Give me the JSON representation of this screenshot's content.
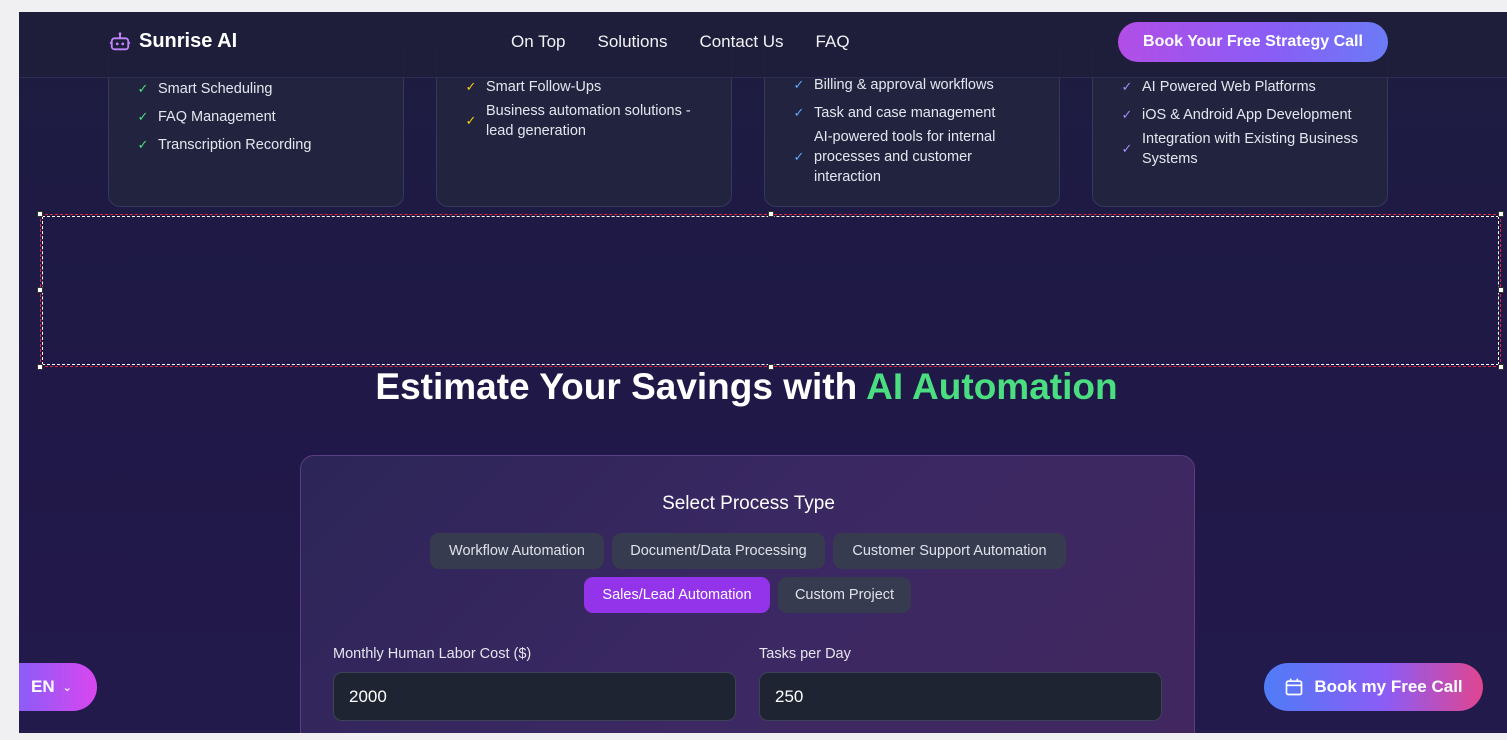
{
  "header": {
    "brand": "Sunrise AI",
    "nav": [
      "On Top",
      "Solutions",
      "Contact Us",
      "FAQ"
    ],
    "cta_label": "Book Your Free Strategy Call"
  },
  "cards": [
    {
      "items": [
        "Smart Scheduling",
        "FAQ Management",
        "Transcription Recording"
      ]
    },
    {
      "items": [
        "Smart Follow-Ups",
        "Business automation solutions - lead generation"
      ]
    },
    {
      "items": [
        "Billing & approval workflows",
        "Task and case management",
        "AI-powered tools for internal processes and customer interaction"
      ]
    },
    {
      "items": [
        "AI Powered Web Platforms",
        "iOS & Android App Development",
        "Integration with Existing Business Systems"
      ]
    }
  ],
  "savings": {
    "title_main": "Estimate Your Savings with ",
    "title_accent": "AI Automation",
    "panel_title": "Select Process Type",
    "process_types": [
      "Workflow Automation",
      "Document/Data Processing",
      "Customer Support Automation",
      "Sales/Lead Automation",
      "Custom Project"
    ],
    "selected_process": "Sales/Lead Automation",
    "labor_cost_label": "Monthly Human Labor Cost ($)",
    "labor_cost_value": "2000",
    "tasks_label": "Tasks per Day",
    "tasks_value": "250"
  },
  "floating": {
    "language": "EN",
    "book_label": "Book my Free Call"
  },
  "colors": {
    "accent_green": "#4ade80",
    "active_pill": "#9333ea",
    "selection_border": "#e0283a"
  },
  "icons": [
    "robot-icon",
    "check-icon",
    "chevron-down-icon",
    "calendar-icon"
  ]
}
